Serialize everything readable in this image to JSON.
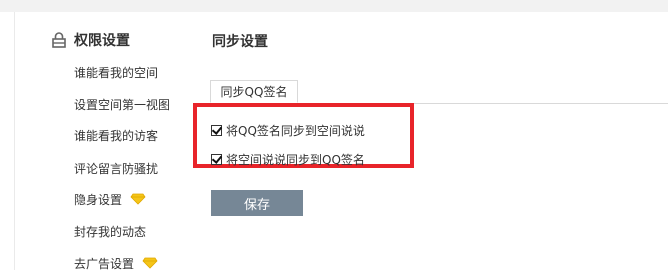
{
  "sidebar": {
    "title": "权限设置",
    "items": [
      {
        "label": "谁能看我的空间"
      },
      {
        "label": "设置空间第一视图"
      },
      {
        "label": "谁能看我的访客"
      },
      {
        "label": "评论留言防骚扰"
      },
      {
        "label": "隐身设置",
        "icon": "diamond-icon"
      },
      {
        "label": "封存我的动态"
      },
      {
        "label": "去广告设置",
        "icon": "diamond-icon"
      }
    ]
  },
  "main": {
    "section_title": "同步设置",
    "tab_label": "同步QQ签名",
    "options": [
      {
        "label": "将QQ签名同步到空间说说",
        "checked": true
      },
      {
        "label": "将空间说说同步到QQ签名",
        "checked": true
      }
    ],
    "save_label": "保存"
  },
  "colors": {
    "highlight": "#e8242a",
    "button": "#768796",
    "diamond": "#f5c518"
  }
}
